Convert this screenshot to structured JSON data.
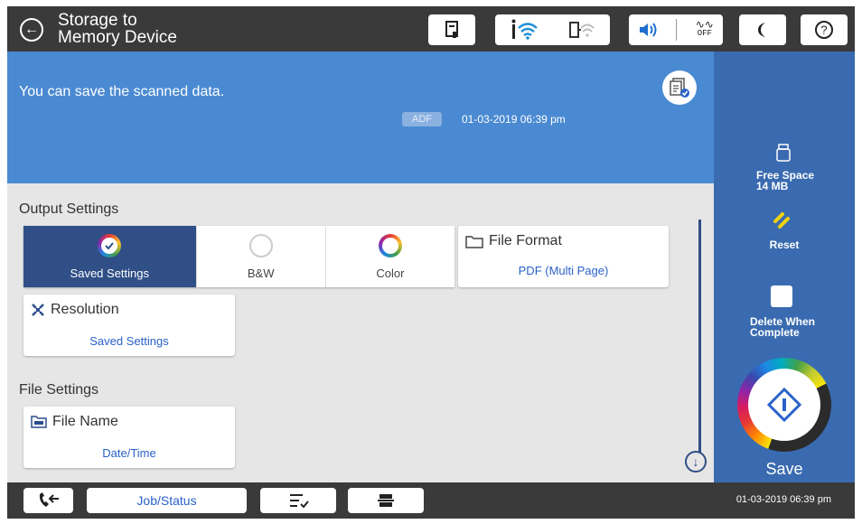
{
  "header": {
    "title_line1": "Storage to",
    "title_line2": "Memory Device",
    "icons": [
      "back-icon",
      "printer-status-icon",
      "wifi-icon",
      "wifi-direct-icon",
      "volume-icon",
      "quiet-off-icon",
      "sleep-icon",
      "help-icon"
    ],
    "quiet_label": "OFF"
  },
  "banner": {
    "message": "You can save the scanned data.",
    "source_badge": "ADF",
    "datetime": "01-03-2019 06:39 pm"
  },
  "output_settings": {
    "heading": "Output Settings",
    "color_modes": [
      {
        "label": "Saved Settings",
        "selected": true
      },
      {
        "label": "B&W",
        "selected": false
      },
      {
        "label": "Color",
        "selected": false
      }
    ],
    "file_format": {
      "title": "File Format",
      "value": "PDF (Multi Page)"
    },
    "resolution": {
      "title": "Resolution",
      "value": "Saved Settings"
    }
  },
  "file_settings": {
    "heading": "File Settings",
    "file_name": {
      "title": "File Name",
      "value": "Date/Time"
    }
  },
  "side_panel": {
    "free_space_label": "Free Space",
    "free_space_value": "14 MB",
    "reset_label": "Reset",
    "delete_label_line1": "Delete When",
    "delete_label_line2": "Complete",
    "delete_checked": false,
    "save_label": "Save"
  },
  "bottom_bar": {
    "job_status_label": "Job/Status",
    "datetime": "01-03-2019 06:39 pm"
  },
  "colors": {
    "banner": "#4a8ad2",
    "side_panel": "#3a6bb0",
    "selected_tile": "#2f4f86",
    "link_text": "#2a62c9",
    "bar": "#3a3a3a"
  }
}
